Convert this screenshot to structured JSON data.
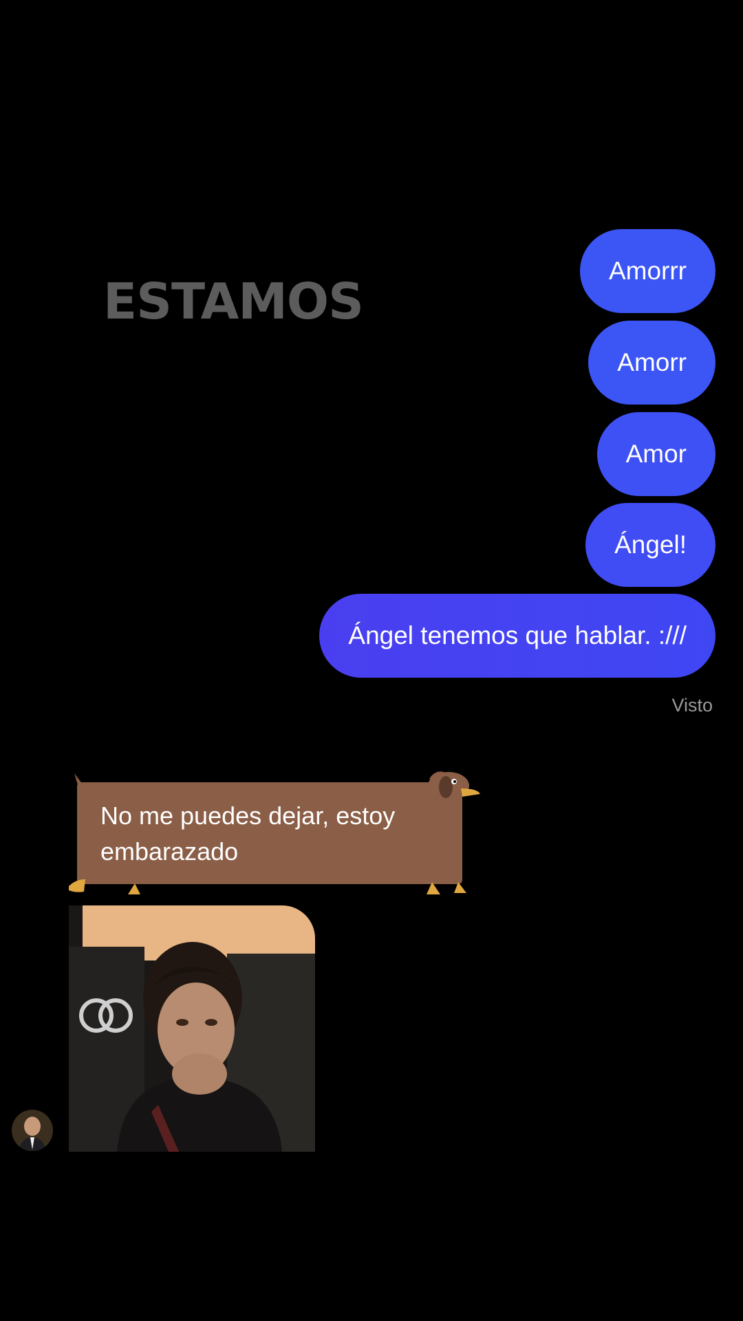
{
  "overlay": {
    "caption": "ESTAMOS"
  },
  "chat": {
    "sent_messages": [
      "Amorrr",
      "Amorr",
      "Amor",
      "Ángel!",
      "Ángel tenemos que hablar. :///"
    ],
    "seen_status": "Visto",
    "received_message": "No me puedes dejar, estoy embarazado",
    "colors": {
      "sent_bubble": "#3b56f5",
      "received_bubble": "#8b5e47",
      "background": "#000000"
    },
    "icons": {
      "received_bubble_decoration": "dachshund-icon",
      "contact_avatar": "avatar-icon"
    }
  }
}
